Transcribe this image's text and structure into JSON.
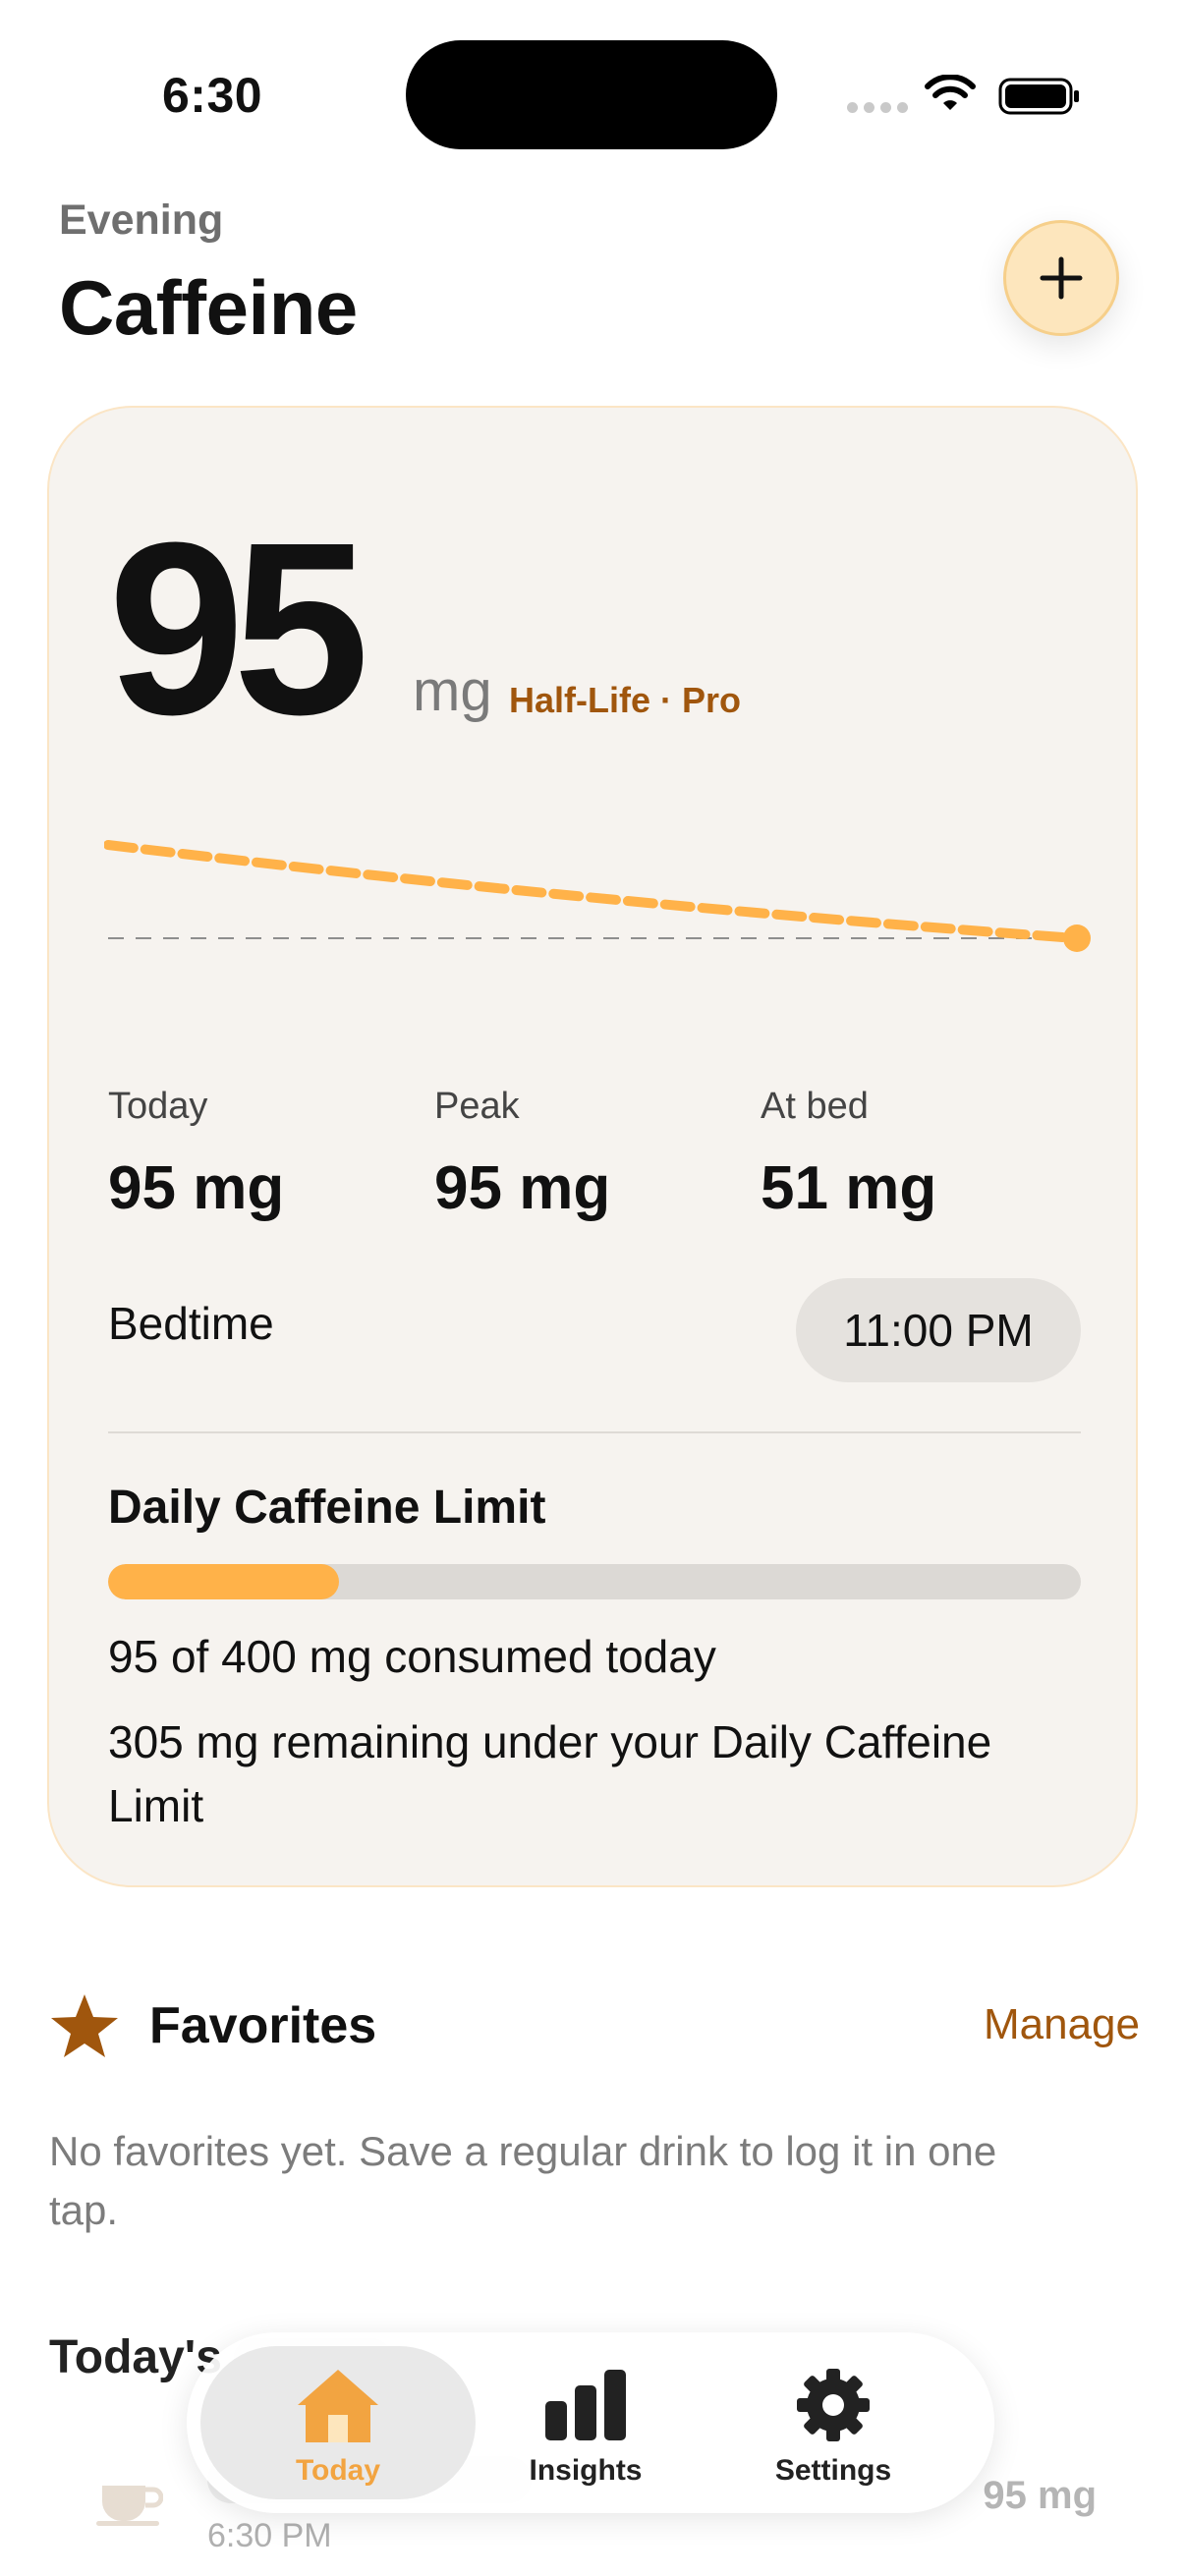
{
  "status_bar": {
    "time": "6:30"
  },
  "header": {
    "eyebrow": "Evening",
    "title": "Caffeine"
  },
  "card": {
    "current_value": "95",
    "unit": "mg",
    "pro_tag": "Half-Life · Pro",
    "stats": [
      {
        "label": "Today",
        "value": "95 mg"
      },
      {
        "label": "Peak",
        "value": "95 mg"
      },
      {
        "label": "At bed",
        "value": "51 mg"
      }
    ],
    "bedtime_label": "Bedtime",
    "bedtime_value": "11:00 PM",
    "limit_title": "Daily Caffeine Limit",
    "limit_progress": 0.2375,
    "consumed_text": "95 of 400 mg consumed today",
    "remaining_text": "305 mg remaining under your Daily Caffeine Limit"
  },
  "favorites": {
    "title": "Favorites",
    "manage_label": "Manage",
    "empty_text": "No favorites yet. Save a regular drink to log it in one tap."
  },
  "todays_log": {
    "title": "Today's",
    "entries": [
      {
        "time": "6:30 PM",
        "amount": "95 mg"
      }
    ]
  },
  "tabs": [
    {
      "label": "Today",
      "icon": "house-icon",
      "active": true
    },
    {
      "label": "Insights",
      "icon": "bar-chart-icon",
      "active": false
    },
    {
      "label": "Settings",
      "icon": "gear-icon",
      "active": false
    }
  ],
  "colors": {
    "accent": "#ffb249",
    "accent_text": "#a0560d",
    "card_bg": "#f6f3ef"
  }
}
